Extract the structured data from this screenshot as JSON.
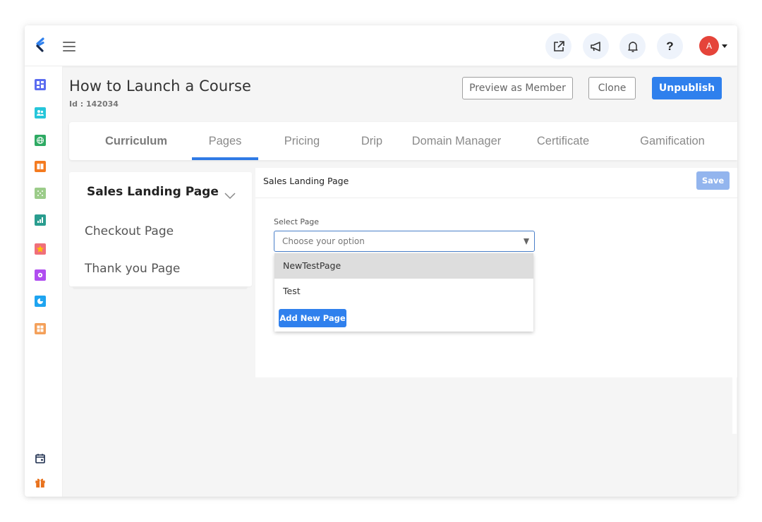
{
  "topbar": {
    "icons": [
      {
        "name": "external-link-icon"
      },
      {
        "name": "megaphone-icon"
      },
      {
        "name": "bell-icon"
      },
      {
        "name": "help-icon",
        "glyph": "?"
      }
    ],
    "avatar_initial": "A"
  },
  "sidebar": {
    "items": [
      {
        "name": "dashboard",
        "color": "#5b6cf0"
      },
      {
        "name": "users",
        "color": "#26c6da"
      },
      {
        "name": "globe",
        "color": "#2eaa63"
      },
      {
        "name": "book",
        "color": "#f47b20"
      },
      {
        "name": "network",
        "color": "#9ccc8a"
      },
      {
        "name": "analytics",
        "color": "#2a9d8f"
      },
      {
        "name": "star",
        "color": "#f06f7a"
      },
      {
        "name": "settings",
        "color": "#b04df0"
      },
      {
        "name": "pie-chart",
        "color": "#1ea4f0"
      },
      {
        "name": "apps",
        "color": "#f4a05a"
      }
    ],
    "bottom_items": [
      {
        "name": "calendar"
      },
      {
        "name": "gift",
        "color": "#e8701a"
      }
    ]
  },
  "header": {
    "title": "How to Launch a Course",
    "id_label": "Id : 142034",
    "buttons": {
      "preview": "Preview as Member",
      "clone": "Clone",
      "unpublish": "Unpublish"
    }
  },
  "tabs": [
    {
      "label": "Curriculum",
      "active": false
    },
    {
      "label": "Pages",
      "active": true
    },
    {
      "label": "Pricing",
      "active": false
    },
    {
      "label": "Drip",
      "active": false
    },
    {
      "label": "Domain Manager",
      "active": false
    },
    {
      "label": "Certificate",
      "active": false
    },
    {
      "label": "Gamification",
      "active": false
    }
  ],
  "pages_list": {
    "items": [
      {
        "label": "Sales Landing Page",
        "active": true
      },
      {
        "label": "Checkout Page",
        "active": false
      },
      {
        "label": "Thank you Page",
        "active": false
      }
    ]
  },
  "editor": {
    "title": "Sales Landing Page",
    "save_label": "Save",
    "select_label": "Select Page",
    "select_placeholder": "Choose your option",
    "options": [
      "NewTestPage",
      "Test"
    ],
    "add_new_label": "Add New Page"
  },
  "colors": {
    "primary": "#2f80ed",
    "save_disabled": "#93b5ee",
    "avatar": "#e5443a",
    "tab_underline": "#2f7ae5"
  }
}
